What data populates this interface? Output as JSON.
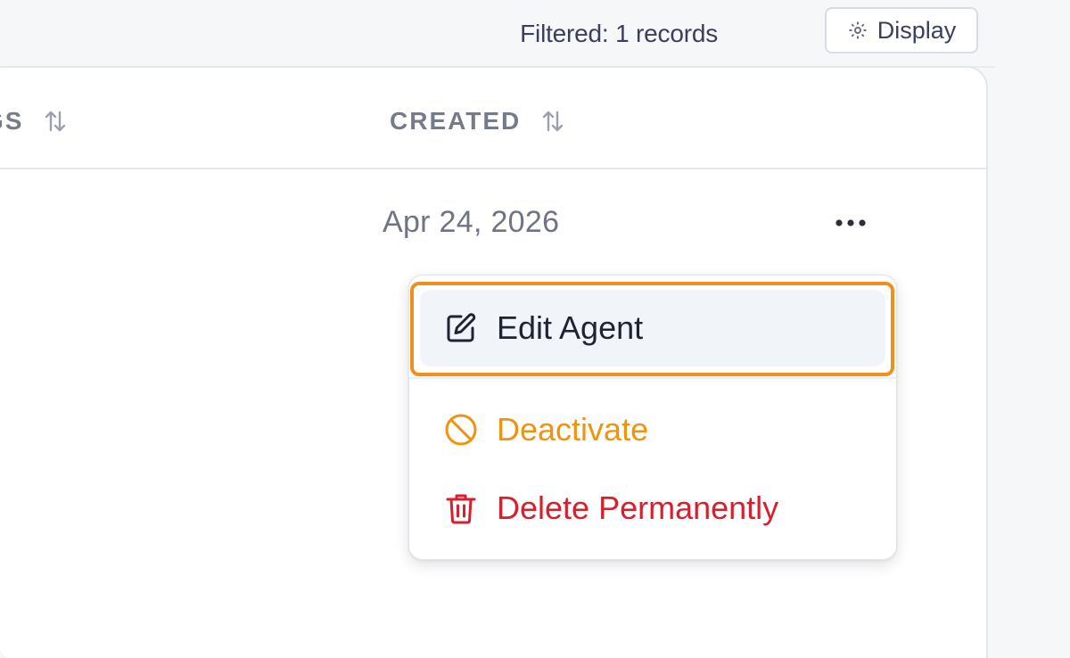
{
  "toolbar": {
    "filtered_text": "Filtered: 1 records",
    "display_label": "Display",
    "display_icon": "gear-icon"
  },
  "table": {
    "columns": [
      {
        "label": "GS",
        "sort_icon": "sort-icon"
      },
      {
        "label": "CREATED",
        "sort_icon": "sort-icon"
      }
    ],
    "rows": [
      {
        "created": "Apr 24, 2026",
        "actions_icon": "more-horizontal-icon"
      }
    ]
  },
  "row_menu": {
    "items": [
      {
        "label": "Edit Agent",
        "icon": "edit-icon",
        "color": "#1f2433",
        "highlighted": true
      },
      {
        "label": "Deactivate",
        "icon": "ban-icon",
        "color": "#f0930f"
      },
      {
        "label": "Delete Permanently",
        "icon": "trash-icon",
        "color": "#d71f2e"
      }
    ],
    "highlight_color": "#f0901a"
  }
}
